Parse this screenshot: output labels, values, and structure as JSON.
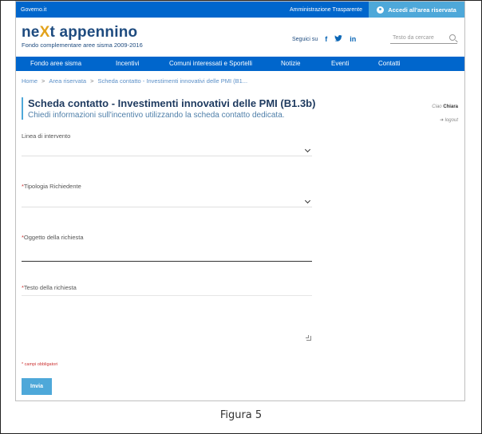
{
  "topbar": {
    "governo": "Governo.it",
    "amministrazione": "Amministrazione Trasparente",
    "accedi": "Accedi all'area riservata"
  },
  "header": {
    "brand_pre": "ne",
    "brand_x": "X",
    "brand_post": "t appennino",
    "tagline": "Fondo complementare aree sisma 2009-2016",
    "seguici": "Seguici su",
    "social": [
      {
        "icon": "facebook-icon",
        "glyph": "f"
      },
      {
        "icon": "twitter-icon",
        "glyph": "🐦"
      },
      {
        "icon": "linkedin-icon",
        "glyph": "in"
      }
    ],
    "search_placeholder": "Testo da cercare"
  },
  "nav": [
    {
      "label": "Fondo aree sisma"
    },
    {
      "label": "Incentivi"
    },
    {
      "label": "Comuni interessati e Sportelli"
    },
    {
      "label": "Notizie"
    },
    {
      "label": "Eventi"
    },
    {
      "label": "Contatti"
    }
  ],
  "breadcrumb": [
    {
      "label": "Home"
    },
    {
      "label": "Area riservata"
    },
    {
      "label": "Scheda contatto - Investimenti innovativi delle PMI (B1..."
    }
  ],
  "page": {
    "title": "Scheda contatto - Investimenti innovativi delle PMI (B1.3b)",
    "subtitle": "Chiedi informazioni sull'incentivo utilizzando la scheda contatto dedicata.",
    "ciao": "Ciao",
    "user": "Chiara",
    "logout": "logout"
  },
  "form": {
    "linea_label": "Linea di intervento",
    "tipologia_label": "Tipologia Richiedente",
    "oggetto_label": "Oggetto della richiesta",
    "testo_label": "Testo della richiesta",
    "required_mark": "*",
    "mandatory_note": "* campi obbligatori",
    "submit": "Invia"
  },
  "caption": "Figura 5"
}
